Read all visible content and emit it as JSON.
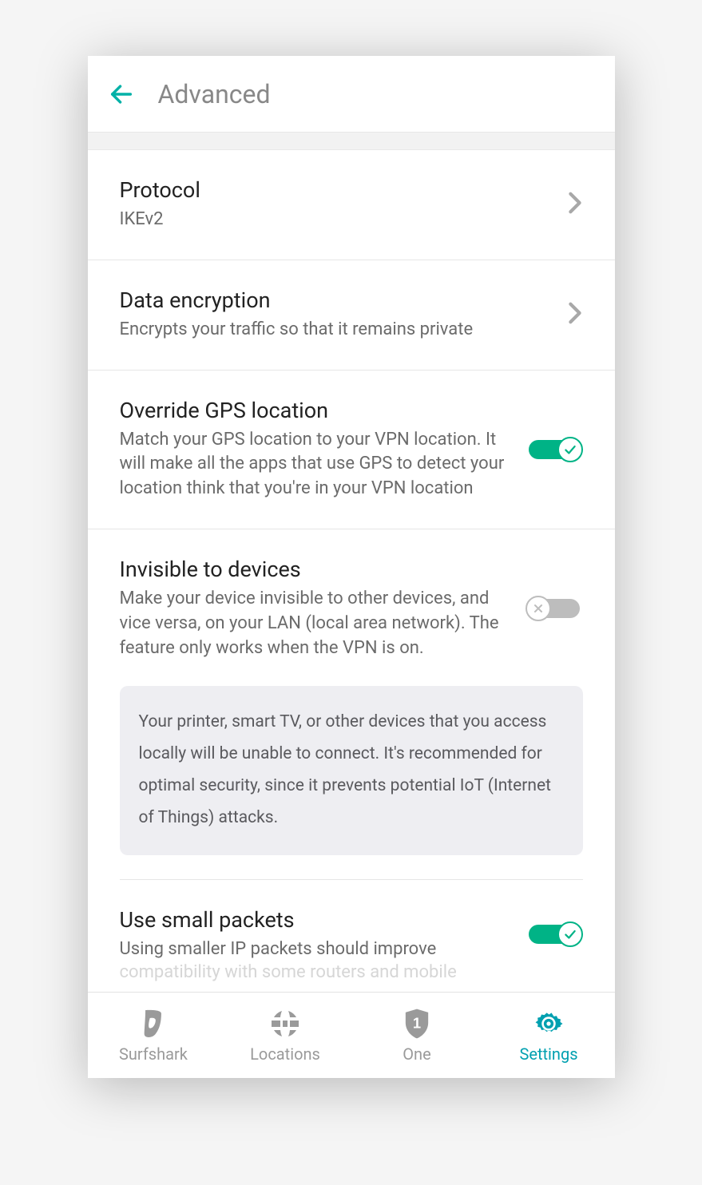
{
  "header": {
    "title": "Advanced"
  },
  "rows": {
    "protocol": {
      "title": "Protocol",
      "value": "IKEv2"
    },
    "encryption": {
      "title": "Data encryption",
      "sub": "Encrypts your traffic so that it remains private"
    },
    "gps": {
      "title": "Override GPS location",
      "sub": "Match your GPS location to your VPN location. It will make all the apps that use GPS to detect your location think that you're in your VPN location",
      "on": true
    },
    "invisible": {
      "title": "Invisible to devices",
      "sub": "Make your device invisible to other devices, and vice versa, on your LAN (local area network). The feature only works when the VPN is on.",
      "on": false,
      "info": "Your printer, smart TV, or other devices that you access locally will be unable to connect. It's recommended for optimal security, since it prevents potential IoT (Internet of Things) attacks."
    },
    "packets": {
      "title": "Use small packets",
      "sub": "Using smaller IP packets should improve",
      "cutoff": "compatibility with some routers and mobile",
      "on": true
    }
  },
  "nav": {
    "surfshark": "Surfshark",
    "locations": "Locations",
    "one": "One",
    "settings": "Settings"
  }
}
